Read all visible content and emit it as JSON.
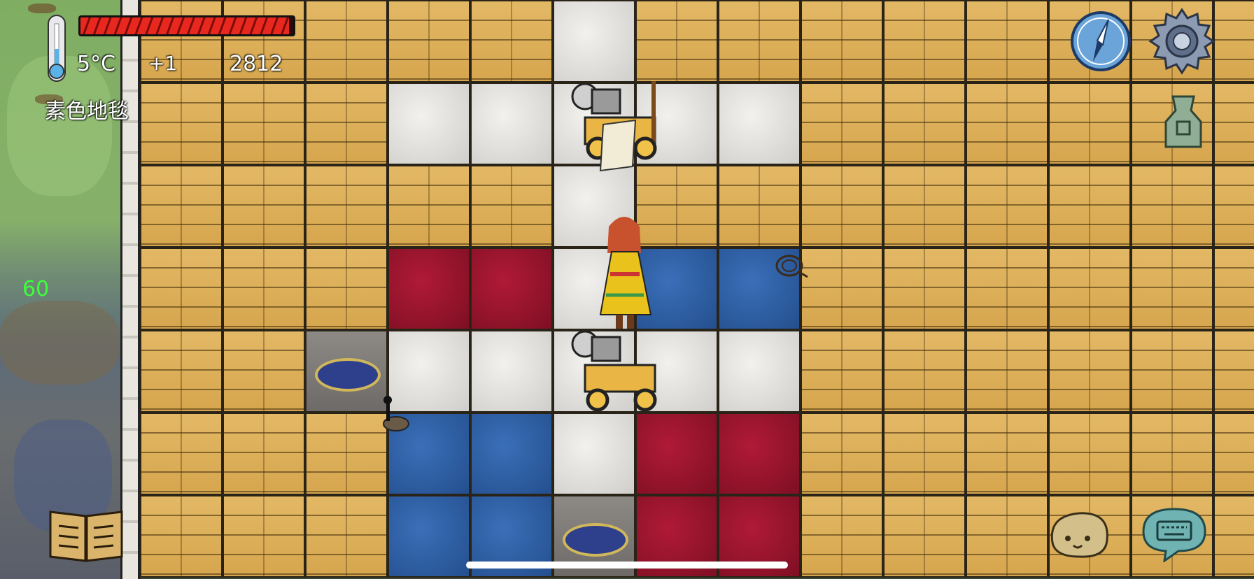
{
  "hud": {
    "temperature": "5°C",
    "modifier": "+1",
    "score": "2812",
    "item_name": "素色地毯",
    "fps": "60",
    "health_fraction": 0.98
  },
  "icons": {
    "thermometer": "thermometer-icon",
    "health": "health-bar",
    "compass": "compass-icon",
    "settings": "gear-icon",
    "totem": "ancient-coin-icon",
    "emote": "emote-face-icon",
    "keyboard": "keyboard-chat-icon",
    "book": "recipe-book-icon"
  },
  "colors": {
    "health_red": "#e8281f",
    "fps_green": "#3cff3c",
    "rug_red": "#9a1530",
    "rug_blue": "#2f5ea3",
    "rug_white": "#e6e5e2",
    "wood": "#d9aa55"
  },
  "board": {
    "rows": [
      [
        "wood",
        "wood",
        "wood",
        "wood",
        "wood",
        "white",
        "wood",
        "wood",
        "wood",
        "wood",
        "wood",
        "wood",
        "wood",
        "wood"
      ],
      [
        "wood",
        "wood",
        "wood",
        "white",
        "white",
        "white",
        "white",
        "white",
        "wood",
        "wood",
        "wood",
        "wood",
        "wood",
        "wood"
      ],
      [
        "wood",
        "wood",
        "wood",
        "wood",
        "wood",
        "white",
        "wood",
        "wood",
        "wood",
        "wood",
        "wood",
        "wood",
        "wood",
        "wood"
      ],
      [
        "wood",
        "wood",
        "wood",
        "red",
        "red",
        "white",
        "blue",
        "blue",
        "wood",
        "wood",
        "wood",
        "wood",
        "wood",
        "wood"
      ],
      [
        "wood",
        "wood",
        "swamp",
        "white",
        "white",
        "white",
        "white",
        "white",
        "wood",
        "wood",
        "wood",
        "wood",
        "wood",
        "wood"
      ],
      [
        "wood",
        "wood",
        "wood",
        "blue",
        "blue",
        "white",
        "red",
        "red",
        "wood",
        "wood",
        "wood",
        "wood",
        "wood",
        "wood"
      ],
      [
        "wood",
        "wood",
        "wood",
        "blue",
        "blue",
        "swamp",
        "red",
        "red",
        "wood",
        "wood",
        "wood",
        "wood",
        "wood",
        "wood"
      ]
    ]
  }
}
